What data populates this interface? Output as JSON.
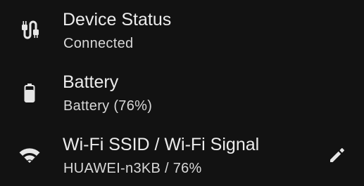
{
  "items": [
    {
      "icon": "usb-cable-icon",
      "title": "Device Status",
      "subtitle": "Connected"
    },
    {
      "icon": "battery-icon",
      "title": "Battery",
      "subtitle": "Battery (76%)"
    },
    {
      "icon": "wifi-icon",
      "title": "Wi-Fi SSID / Wi-Fi Signal",
      "subtitle": "HUAWEI-n3KB / 76%",
      "action_icon": "edit-pencil-icon"
    }
  ],
  "colors": {
    "background": "#121212",
    "text_primary": "#ececec",
    "text_secondary": "#d8d8d8",
    "icon": "#e6e6e6"
  },
  "battery_level": 0.76
}
